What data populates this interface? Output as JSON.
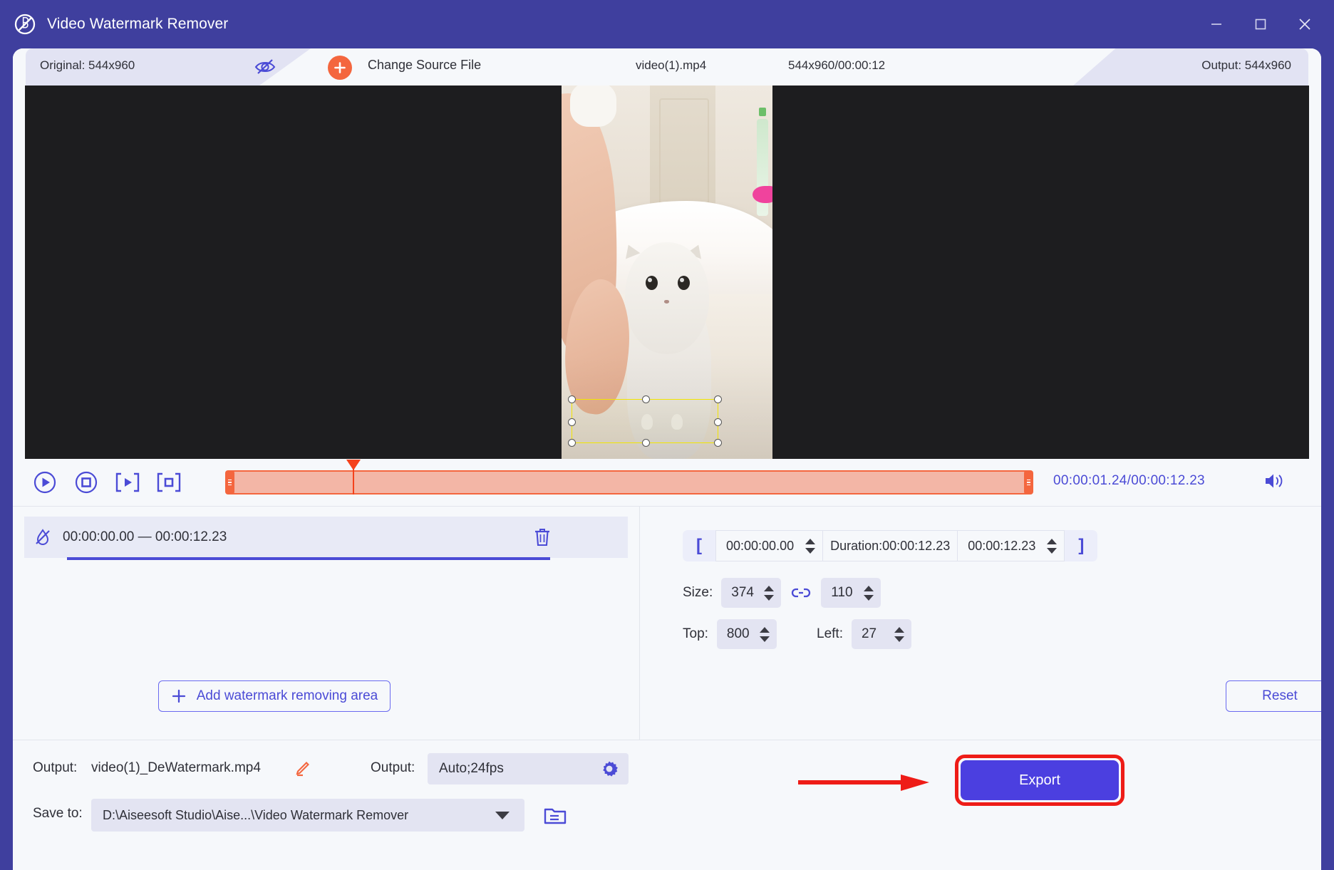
{
  "window": {
    "title": "Video Watermark Remover",
    "logo_icon": "watermark-logo-icon",
    "minimize_icon": "minimize-icon",
    "maximize_icon": "maximize-icon",
    "close_icon": "close-icon"
  },
  "source_bar": {
    "original_label": "Original: 544x960",
    "preview_toggle_icon": "eye-off-icon",
    "add_icon": "plus-icon",
    "change_source_label": "Change Source File",
    "file_name": "video(1).mp4",
    "file_meta": "544x960/00:00:12",
    "output_label": "Output: 544x960"
  },
  "preview": {
    "selection": {
      "handles": 8,
      "color": "#f2e500"
    }
  },
  "playback": {
    "play_icon": "play-circle-icon",
    "stop_icon": "stop-circle-icon",
    "set_start_icon": "set-in-point-icon",
    "set_end_icon": "set-out-point-icon",
    "current_time": "00:00:01.24/00:00:12.23",
    "volume_icon": "volume-icon",
    "playhead_percent": 15.7
  },
  "area_list": {
    "items": [
      {
        "icon": "watermark-area-icon",
        "range": "00:00:00.00 — 00:00:12.23",
        "delete_icon": "trash-icon"
      }
    ],
    "add_button": {
      "icon": "plus-icon",
      "label": "Add watermark removing area"
    }
  },
  "properties": {
    "start_bracket": "[",
    "end_bracket": "]",
    "start_time": "00:00:00.00",
    "duration_label": "Duration:00:00:12.23",
    "end_time": "00:00:12.23",
    "size_label": "Size:",
    "size_width": "374",
    "size_height": "110",
    "link_icon": "link-icon",
    "top_label": "Top:",
    "top_value": "800",
    "left_label": "Left:",
    "left_value": "27",
    "reset_label": "Reset"
  },
  "output_bar": {
    "output_name_label": "Output:",
    "output_file_name": "video(1)_DeWatermark.mp4",
    "rename_icon": "pencil-icon",
    "output_format_label": "Output:",
    "output_format_value": "Auto;24fps",
    "settings_icon": "gear-icon",
    "save_to_label": "Save to:",
    "save_to_path": "D:\\Aiseesoft Studio\\Aise...\\Video Watermark Remover",
    "dropdown_icon": "chevron-down-icon",
    "browse_icon": "folder-icon",
    "export_label": "Export"
  },
  "annotation": {
    "arrow_icon": "red-arrow-icon",
    "highlight_color": "#ee1c17"
  },
  "colors": {
    "brand_purple": "#3f3f9e",
    "accent_blue": "#4b4bd6",
    "accent_orange": "#f4663e",
    "export_blue": "#4b3fe0",
    "panel_bg": "#f6f8fb",
    "selection_yellow": "#f2e500"
  }
}
